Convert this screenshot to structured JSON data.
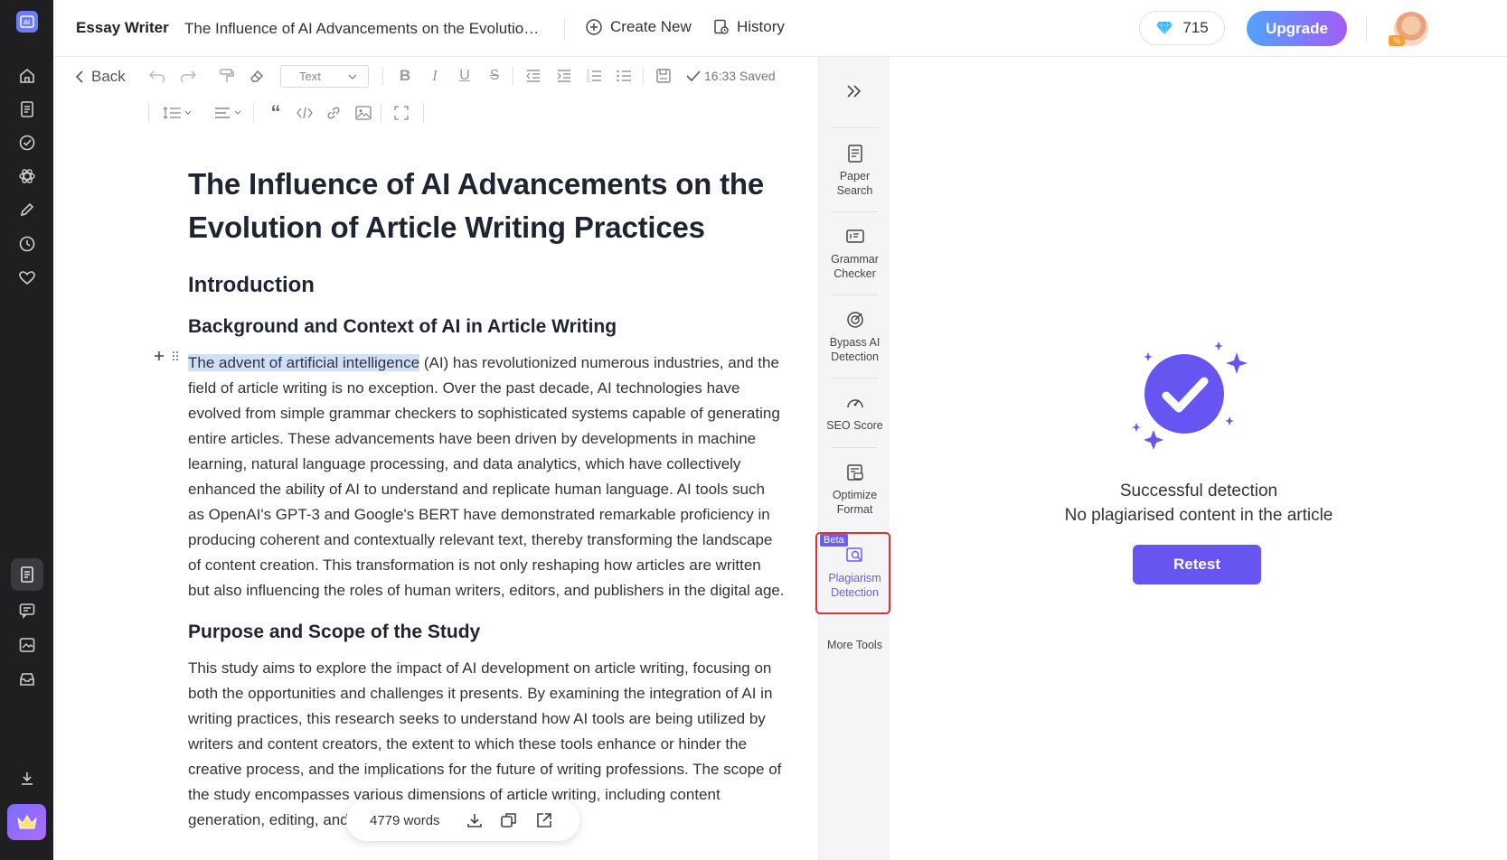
{
  "header": {
    "app_name": "Essay Writer",
    "doc_title": "The Influence of AI Advancements on the Evolution of Article Writing Practices",
    "create_new": "Create New",
    "history": "History",
    "credits": "715",
    "upgrade": "Upgrade"
  },
  "toolbar": {
    "back": "Back",
    "text_style": "Text",
    "saved_status": "16:33 Saved"
  },
  "document": {
    "title": "The Influence of AI Advancements on the Evolution of Article Writing Practices",
    "section1": "Introduction",
    "subsection1": "Background and Context of AI in Article Writing",
    "para1_highlight": "The advent of artificial intelligence",
    "para1_rest": " (AI) has revolutionized numerous industries, and the field of article writing is no exception. Over the past decade, AI technologies have evolved from simple grammar checkers to sophisticated systems capable of generating entire articles. These advancements have been driven by developments in machine learning, natural language processing, and data analytics, which have collectively enhanced the ability of AI to understand and replicate human language. AI tools such as OpenAI's GPT-3 and Google's BERT have demonstrated remarkable proficiency in producing coherent and contextually relevant text, thereby transforming the landscape of content creation. This transformation is not only reshaping how articles are written but also influencing the roles of human writers, editors, and publishers in the digital age.",
    "subsection2": "Purpose and Scope of the Study",
    "para2": "This study aims to explore the impact of AI development on article writing, focusing on both the opportunities and challenges it presents. By examining the integration of AI in writing practices, this research seeks to understand how AI tools are being utilized by writers and content creators, the extent to which these tools enhance or hinder the creative process, and the implications for the future of writing professions. The scope of the study encompasses various dimensions of article writing, including content generation, editing, and publication, while also"
  },
  "word_count": "4779 words",
  "tools": [
    {
      "label": "Paper Search",
      "icon": "paper-search-icon"
    },
    {
      "label": "Grammar Checker",
      "icon": "grammar-checker-icon"
    },
    {
      "label": "Bypass AI Detection",
      "icon": "bypass-ai-icon"
    },
    {
      "label": "SEO Score",
      "icon": "seo-score-icon"
    },
    {
      "label": "Optimize Format",
      "icon": "optimize-format-icon"
    },
    {
      "label": "Plagiarism Detection",
      "icon": "plagiarism-icon",
      "badge": "Beta",
      "active": true
    },
    {
      "label": "More Tools",
      "icon": "more-tools-icon"
    }
  ],
  "result": {
    "line1": "Successful detection",
    "line2": "No plagiarised content in the article",
    "retest": "Retest"
  },
  "colors": {
    "accent": "#6655f0",
    "highlight": "#cfe0ff",
    "rail": "#1f1f22",
    "frame": "#e03030"
  }
}
